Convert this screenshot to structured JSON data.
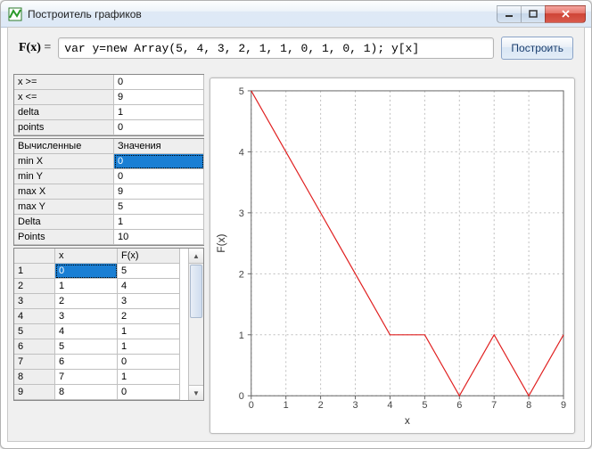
{
  "window": {
    "title": "Построитель графиков"
  },
  "formula": {
    "label_prefix": "F(x)",
    "label_eq": " = ",
    "value": "var y=new Array(5, 4, 3, 2, 1, 1, 0, 1, 0, 1); y[x]"
  },
  "build_button": "Построить",
  "params": {
    "rows": [
      {
        "k": "x >=",
        "v": "0"
      },
      {
        "k": "x <=",
        "v": "9"
      },
      {
        "k": "delta",
        "v": "1"
      },
      {
        "k": "points",
        "v": "0"
      }
    ]
  },
  "computed": {
    "header": {
      "k": "Вычисленные",
      "v": "Значения"
    },
    "rows": [
      {
        "k": "min X",
        "v": "0",
        "sel": true
      },
      {
        "k": "min Y",
        "v": "0"
      },
      {
        "k": "max X",
        "v": "9"
      },
      {
        "k": "max Y",
        "v": "5"
      },
      {
        "k": "Delta",
        "v": "1"
      },
      {
        "k": "Points",
        "v": "10"
      }
    ]
  },
  "table": {
    "headers": {
      "idx": "",
      "x": "x",
      "fx": "F(x)"
    },
    "rows": [
      {
        "i": "1",
        "x": "0",
        "fx": "5",
        "sel": true
      },
      {
        "i": "2",
        "x": "1",
        "fx": "4"
      },
      {
        "i": "3",
        "x": "2",
        "fx": "3"
      },
      {
        "i": "4",
        "x": "3",
        "fx": "2"
      },
      {
        "i": "5",
        "x": "4",
        "fx": "1"
      },
      {
        "i": "6",
        "x": "5",
        "fx": "1"
      },
      {
        "i": "7",
        "x": "6",
        "fx": "0"
      },
      {
        "i": "8",
        "x": "7",
        "fx": "1"
      },
      {
        "i": "9",
        "x": "8",
        "fx": "0"
      }
    ]
  },
  "chart_data": {
    "type": "line",
    "x": [
      0,
      1,
      2,
      3,
      4,
      5,
      6,
      7,
      8,
      9
    ],
    "y": [
      5,
      4,
      3,
      2,
      1,
      1,
      0,
      1,
      0,
      1
    ],
    "xlabel": "x",
    "ylabel": "F(x)",
    "xlim": [
      0,
      9
    ],
    "ylim": [
      0,
      5
    ],
    "xticks": [
      0,
      1,
      2,
      3,
      4,
      5,
      6,
      7,
      8,
      9
    ],
    "yticks": [
      0,
      1,
      2,
      3,
      4,
      5
    ]
  }
}
